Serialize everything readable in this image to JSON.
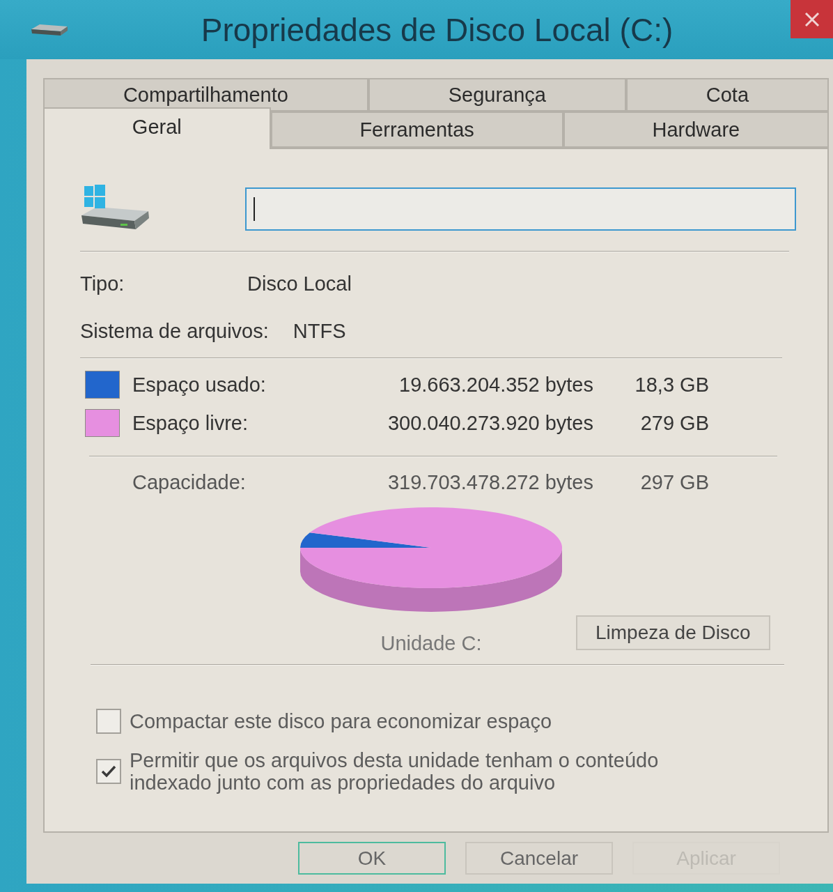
{
  "window": {
    "title": "Propriedades de Disco Local (C:)"
  },
  "tab_rows": [
    {
      "tabs": [
        {
          "label": "Compartilhamento",
          "selected": false
        },
        {
          "label": "Segurança",
          "selected": false
        },
        {
          "label": "Cota",
          "selected": false
        }
      ]
    },
    {
      "tabs": [
        {
          "label": "Geral",
          "selected": true
        },
        {
          "label": "Ferramentas",
          "selected": false
        },
        {
          "label": "Hardware",
          "selected": false
        }
      ]
    }
  ],
  "name_field": {
    "focused": true
  },
  "properties": [
    {
      "label": "Tipo:",
      "value": "Disco Local"
    },
    {
      "label": "Sistema de arquivos:",
      "value": "NTFS"
    }
  ],
  "space": [
    {
      "label": "Espaço usado:",
      "bytes": "19.663.204.352 bytes",
      "size": "18,3 GB",
      "color": "#2266cc"
    },
    {
      "label": "Espaço livre:",
      "bytes": "300.040.273.920 bytes",
      "size": "279 GB",
      "color": "#e68fe0"
    }
  ],
  "capacity": {
    "label": "Capacidade:",
    "bytes": "319.703.478.272 bytes",
    "size": "297 GB"
  },
  "chart": {
    "caption": "Unidade C:"
  },
  "cleanup_button": "Limpeza de Disco",
  "options": [
    {
      "label": "Compactar este disco para economizar espaço",
      "checked": false
    },
    {
      "label": "Permitir que os arquivos desta unidade tenham o conteúdo indexado junto com as propriedades do arquivo",
      "checked": true
    }
  ],
  "buttons": [
    {
      "label": "OK",
      "default": true,
      "disabled": false
    },
    {
      "label": "Cancelar",
      "default": false,
      "disabled": false
    },
    {
      "label": "Aplicar",
      "default": false,
      "disabled": true
    }
  ]
}
